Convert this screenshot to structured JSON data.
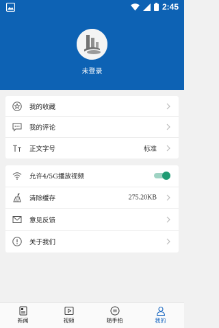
{
  "status_bar": {
    "time": "2:45"
  },
  "profile": {
    "login_label": "未登录",
    "avatar_icon": "user-avatar-icon"
  },
  "settings_group1": [
    {
      "label": "我的收藏",
      "value": "",
      "icon": "star-icon"
    },
    {
      "label": "我的评论",
      "value": "",
      "icon": "comment-icon"
    },
    {
      "label": "正文字号",
      "value": "标准",
      "icon": "font-size-icon"
    }
  ],
  "settings_group2": [
    {
      "label": "允许4/5G播放视频",
      "value": "",
      "icon": "wifi-icon",
      "toggle_on": true
    },
    {
      "label": "清除缓存",
      "value": "275.20KB",
      "icon": "broom-icon"
    },
    {
      "label": "意见反馈",
      "value": "",
      "icon": "mail-icon"
    },
    {
      "label": "关于我们",
      "value": "",
      "icon": "info-icon"
    }
  ],
  "tabs": [
    {
      "label": "新闻",
      "icon": "news-icon",
      "active": false
    },
    {
      "label": "视频",
      "icon": "video-icon",
      "active": false
    },
    {
      "label": "随手拍",
      "icon": "chat-icon",
      "active": false
    },
    {
      "label": "我的",
      "icon": "person-icon",
      "active": true
    }
  ],
  "colors": {
    "header": "#0d62b4",
    "accent": "#1565c0",
    "toggle": "#1f9b73"
  }
}
